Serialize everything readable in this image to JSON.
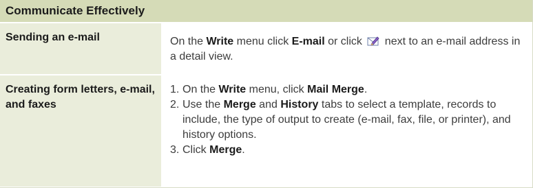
{
  "header": {
    "title": "Communicate Effectively"
  },
  "rows": [
    {
      "label": "Sending an e-mail",
      "content": {
        "t1": "On the ",
        "b1": "Write",
        "t2": " menu click ",
        "b2": "E-mail",
        "t3": " or click ",
        "icon": "email-pencil-icon",
        "t4": " next to an e-mail address in a detail view."
      }
    },
    {
      "label": "Creating form letters, e-mail, and faxes",
      "steps": [
        {
          "num": "1.",
          "t1": "On the ",
          "b1": "Write",
          "t2": " menu, click ",
          "b2": "Mail Merge",
          "t3": "."
        },
        {
          "num": "2.",
          "t1": "Use the ",
          "b1": "Merge",
          "t2": " and ",
          "b2": "History",
          "t3": " tabs to select a template, records to include, the type of output to create (e-mail, fax, file, or printer), and history options."
        },
        {
          "num": "3.",
          "t1": "Click ",
          "b1": "Merge",
          "t2": "."
        }
      ]
    }
  ]
}
